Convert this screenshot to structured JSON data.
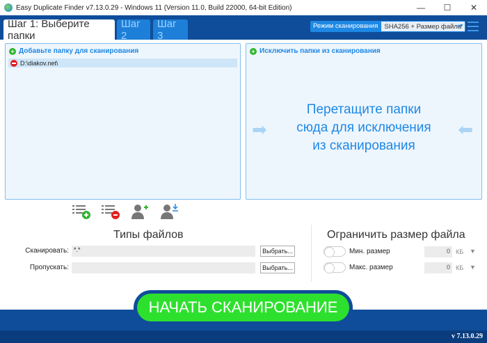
{
  "window": {
    "title": "Easy Duplicate Finder v7.13.0.29 - Windows 11 (Version 11.0, Build 22000, 64-bit Edition)",
    "minimize": "—",
    "maximize": "☐",
    "close": "✕"
  },
  "tabs": [
    {
      "label": "Шаг 1: Выберите папки"
    },
    {
      "label": "Шаг 2"
    },
    {
      "label": "Шаг 3"
    }
  ],
  "scan_mode": {
    "label": "Режим сканирования",
    "value": "SHA256 + Размер файла"
  },
  "include_panel": {
    "title": "Добавьте папку для сканирования",
    "folders": [
      "D:\\diakov.net\\"
    ]
  },
  "exclude_panel": {
    "title": "Исключить папки из сканирования",
    "drop_hint": [
      "Перетащите папки",
      "сюда для исключения",
      "из сканирования"
    ]
  },
  "file_types": {
    "title": "Типы файлов",
    "scan_label": "Сканировать:",
    "scan_value": "*.*",
    "skip_label": "Пропускать:",
    "skip_value": "",
    "pick_label": "Выбрать..."
  },
  "size_limit": {
    "title": "Ограничить размер файла",
    "min_label": "Мин. размер",
    "min_value": "0",
    "max_label": "Макс. размер",
    "max_value": "0",
    "unit": "КБ",
    "min_enabled": false,
    "max_enabled": false
  },
  "start_button": "НАЧАТЬ СКАНИРОВАНИЕ",
  "version": "v 7.13.0.29",
  "colors": {
    "header": "#0f4d9a",
    "accent": "#1e88e5",
    "start": "#2ee02e"
  }
}
